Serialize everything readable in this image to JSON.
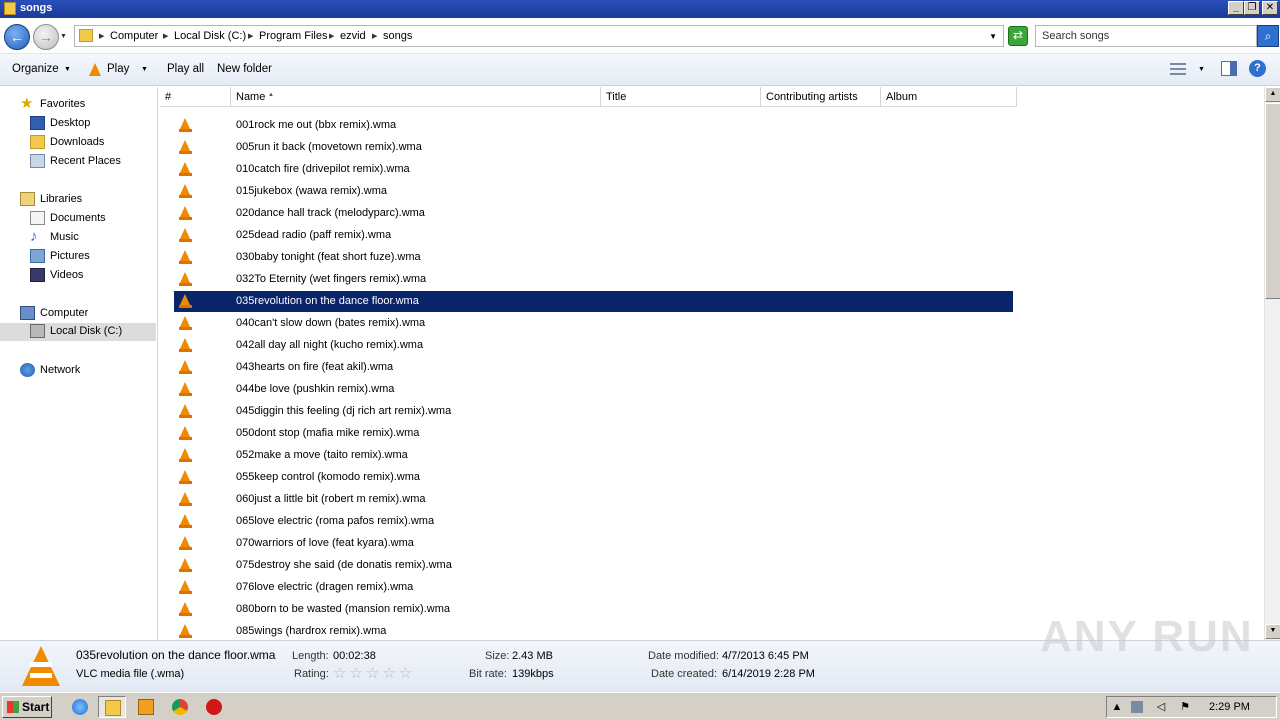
{
  "window": {
    "title": "songs"
  },
  "address": {
    "breadcrumbs": [
      "Computer",
      "Local Disk (C:)",
      "Program Files",
      "ezvid",
      "songs"
    ],
    "search_placeholder": "Search songs"
  },
  "toolbar": {
    "organize": "Organize",
    "play": "Play",
    "play_all": "Play all",
    "new_folder": "New folder"
  },
  "nav": {
    "favorites": {
      "label": "Favorites",
      "items": [
        "Desktop",
        "Downloads",
        "Recent Places"
      ]
    },
    "libraries": {
      "label": "Libraries",
      "items": [
        "Documents",
        "Music",
        "Pictures",
        "Videos"
      ]
    },
    "computer": {
      "label": "Computer",
      "items": [
        "Local Disk (C:)"
      ]
    },
    "network": {
      "label": "Network"
    }
  },
  "columns": [
    "#",
    "Name",
    "Title",
    "Contributing artists",
    "Album"
  ],
  "sorted_column": "Name",
  "files": [
    "001rock me out (bbx remix).wma",
    "005run it back (movetown remix).wma",
    "010catch fire (drivepilot remix).wma",
    "015jukebox (wawa remix).wma",
    "020dance hall track (melodyparc).wma",
    "025dead radio (paff remix).wma",
    "030baby tonight (feat short fuze).wma",
    "032To Eternity (wet fingers remix).wma",
    "035revolution on the dance floor.wma",
    "040can't slow down (bates remix).wma",
    "042all day all night (kucho remix).wma",
    "043hearts on fire (feat akil).wma",
    "044be love (pushkin remix).wma",
    "045diggin this feeling (dj rich art remix).wma",
    "050dont stop (mafia mike remix).wma",
    "052make a move (taito remix).wma",
    "055keep control (komodo remix).wma",
    "060just a little bit (robert m remix).wma",
    "065love electric (roma pafos remix).wma",
    "070warriors of love (feat kyara).wma",
    "075destroy she said (de donatis remix).wma",
    "076love electric (dragen remix).wma",
    "080born to be wasted (mansion remix).wma",
    "085wings (hardrox remix).wma"
  ],
  "selected_file": "035revolution on the dance floor.wma",
  "details": {
    "name": "035revolution on the dance floor.wma",
    "type": "VLC media file (.wma)",
    "length_label": "Length:",
    "length": "00:02:38",
    "rating_label": "Rating:",
    "rating_stars": 0,
    "size_label": "Size:",
    "size": "2.43 MB",
    "bitrate_label": "Bit rate:",
    "bitrate": "139kbps",
    "modified_label": "Date modified:",
    "modified": "4/7/2013 6:45 PM",
    "created_label": "Date created:",
    "created": "6/14/2019 2:28 PM"
  },
  "taskbar": {
    "start": "Start",
    "clock": "2:29 PM"
  },
  "watermark": "ANY RUN",
  "colors": {
    "selection": "#0a246a",
    "vlc_orange": "#f08a00",
    "title_bar": "#1a3a9a"
  }
}
